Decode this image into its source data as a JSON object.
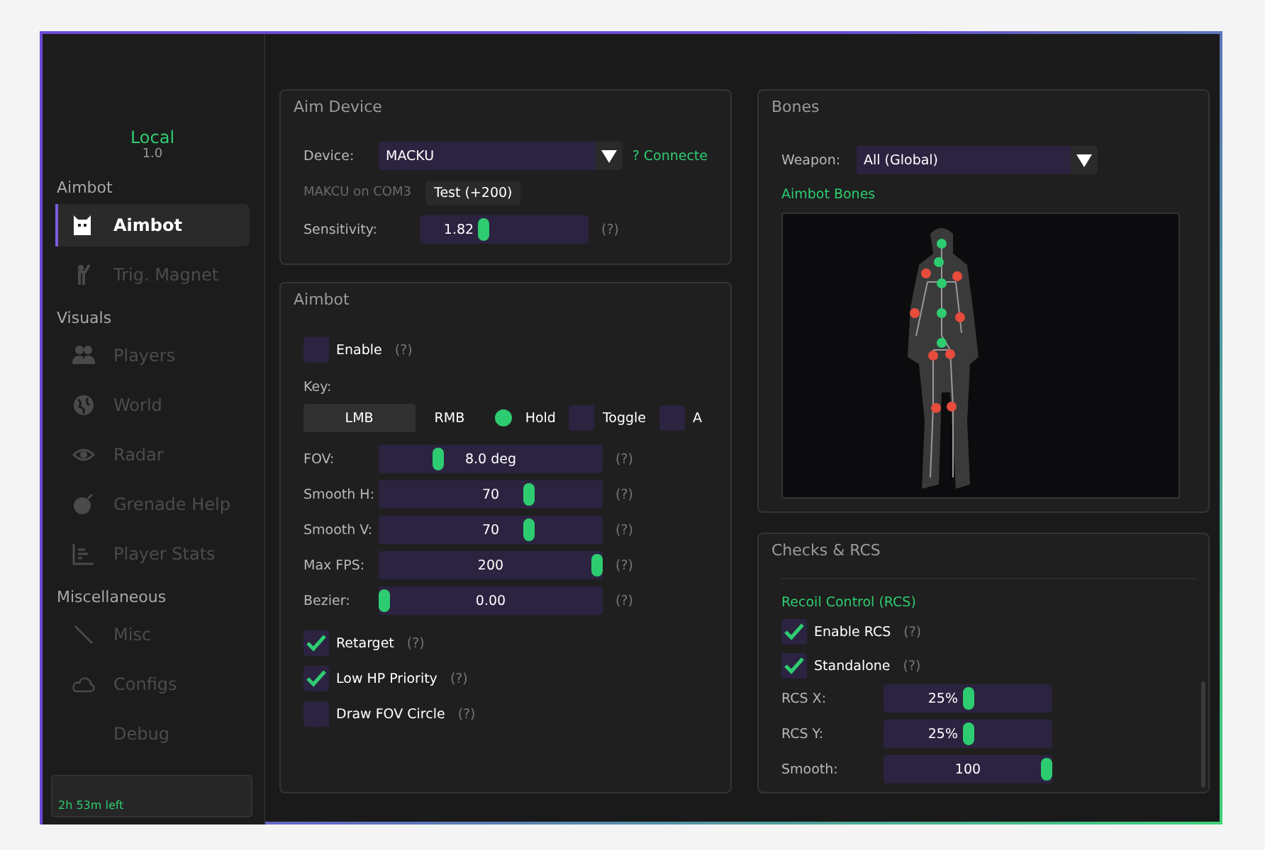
{
  "sidebar": {
    "app_name": "Local",
    "version": "1.0",
    "sections": [
      {
        "title": "Aimbot",
        "items": [
          {
            "label": "Aimbot",
            "selected": true
          },
          {
            "label": "Trig. Magnet",
            "selected": false
          }
        ]
      },
      {
        "title": "Visuals",
        "items": [
          {
            "label": "Players",
            "selected": false
          },
          {
            "label": "World",
            "selected": false
          },
          {
            "label": "Radar",
            "selected": false
          },
          {
            "label": "Grenade Help",
            "selected": false
          },
          {
            "label": "Player Stats",
            "selected": false
          }
        ]
      },
      {
        "title": "Miscellaneous",
        "items": [
          {
            "label": "Misc",
            "selected": false
          },
          {
            "label": "Configs",
            "selected": false
          },
          {
            "label": "Debug",
            "selected": false
          }
        ]
      }
    ],
    "license": "2h 53m left"
  },
  "aim_device": {
    "title": "Aim Device",
    "device": {
      "label": "Device:",
      "value": "MACKU"
    },
    "status": "? Connecte",
    "port": "MAKCU on COM3",
    "test_button": "Test (+200)",
    "sensitivity": {
      "label": "Sensitivity:",
      "value": "1.82",
      "level": 0.37,
      "help": "(?)"
    }
  },
  "aimbot": {
    "title": "Aimbot",
    "enable": {
      "label": "Enable",
      "checked": false,
      "help": "(?)"
    },
    "key_label": "Key:",
    "key_buttons": [
      {
        "label": "LMB",
        "selected": true
      },
      {
        "label": "RMB",
        "selected": false
      }
    ],
    "modes": [
      {
        "label": "Hold",
        "selected": true
      },
      {
        "label": "Toggle",
        "selected": false
      },
      {
        "label": "A",
        "selected": false
      }
    ],
    "sliders": [
      {
        "label": "FOV:",
        "value": "8.0 deg",
        "level": 0.25,
        "help": "(?)"
      },
      {
        "label": "Smooth H:",
        "value": "70",
        "level": 0.68,
        "help": "(?)"
      },
      {
        "label": "Smooth V:",
        "value": "70",
        "level": 0.68,
        "help": "(?)"
      },
      {
        "label": "Max FPS:",
        "value": "200",
        "level": 1.0,
        "help": "(?)"
      },
      {
        "label": "Bezier:",
        "value": "0.00",
        "level": 0.0,
        "help": "(?)"
      }
    ],
    "options": [
      {
        "label": "Retarget",
        "checked": true,
        "help": "(?)"
      },
      {
        "label": "Low HP Priority",
        "checked": true,
        "help": "(?)"
      },
      {
        "label": "Draw FOV Circle",
        "checked": false,
        "help": "(?)"
      }
    ]
  },
  "bones": {
    "title": "Bones",
    "weapon": {
      "label": "Weapon:",
      "value": "All (Global)"
    },
    "subtitle": "Aimbot Bones"
  },
  "checks_rcs": {
    "title": "Checks & RCS",
    "subtitle": "Recoil Control (RCS)",
    "options": [
      {
        "label": "Enable RCS",
        "checked": true,
        "help": "(?)"
      },
      {
        "label": "Standalone",
        "checked": true,
        "help": "(?)"
      }
    ],
    "sliders": [
      {
        "label": "RCS X:",
        "value": "25%",
        "level": 0.5
      },
      {
        "label": "RCS Y:",
        "value": "25%",
        "level": 0.5
      },
      {
        "label": "Smooth:",
        "value": "100",
        "level": 1.0
      }
    ]
  }
}
